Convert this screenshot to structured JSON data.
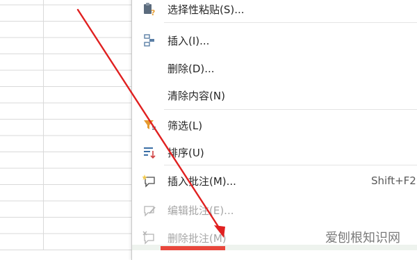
{
  "context_menu": {
    "items": [
      {
        "label": "选择性粘贴(S)...",
        "icon": "paste-special-icon",
        "enabled": true
      },
      {
        "label": "插入(I)...",
        "icon": "insert-icon",
        "enabled": true
      },
      {
        "label": "删除(D)...",
        "icon": "",
        "enabled": true
      },
      {
        "label": "清除内容(N)",
        "icon": "",
        "enabled": true
      },
      {
        "label": "筛选(L)",
        "icon": "filter-icon",
        "enabled": true
      },
      {
        "label": "排序(U)",
        "icon": "sort-icon",
        "enabled": true
      },
      {
        "label": "插入批注(M)...",
        "icon": "insert-comment-icon",
        "enabled": true,
        "shortcut": "Shift+F2"
      },
      {
        "label": "编辑批注(E)...",
        "icon": "edit-comment-icon",
        "enabled": false
      },
      {
        "label": "删除批注(M)",
        "icon": "delete-comment-icon",
        "enabled": false
      }
    ]
  },
  "annotation": {
    "arrow_color": "#e02020"
  },
  "watermark": {
    "text": "爱刨根知识网"
  },
  "colors": {
    "accent_bar": "#e8473c",
    "grid_line": "#d9d9d9"
  }
}
